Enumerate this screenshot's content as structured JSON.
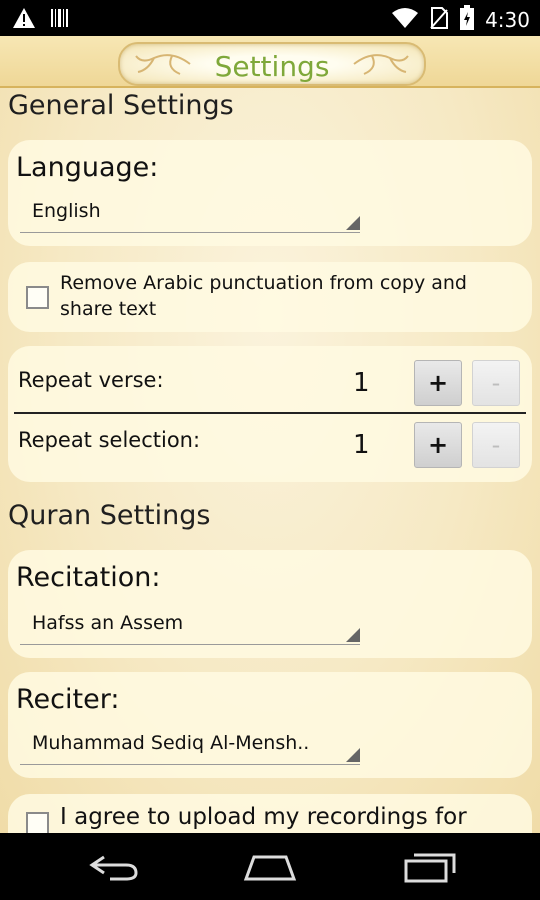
{
  "status_bar": {
    "time": "4:30",
    "icons": [
      "warning-icon",
      "barcode-icon",
      "wifi-icon",
      "no-sim-icon",
      "battery-icon"
    ]
  },
  "title": "Settings",
  "general": {
    "header": "General Settings",
    "language": {
      "label": "Language:",
      "value": "English"
    },
    "remove_punctuation": {
      "text": "Remove Arabic punctuation from copy and share text",
      "checked": false
    },
    "repeat_verse": {
      "label": "Repeat verse:",
      "count": "1",
      "plus": "+",
      "minus": "-"
    },
    "repeat_selection": {
      "label": "Repeat selection:",
      "count": "1",
      "plus": "+",
      "minus": "-"
    }
  },
  "quran": {
    "header": "Quran Settings",
    "recitation": {
      "label": "Recitation:",
      "value": "Hafss an Assem"
    },
    "reciter": {
      "label": "Reciter:",
      "value": "Muhammad Sediq Al-Mensh.."
    },
    "upload_agree": {
      "text": "I agree to upload my recordings for",
      "checked": false
    }
  },
  "nav_bar": {
    "icons": [
      "back-icon",
      "home-icon",
      "recents-icon"
    ]
  },
  "colors": {
    "title_text": "#7fa83a",
    "background": "#f6e9c4",
    "card": "#fffae2"
  }
}
